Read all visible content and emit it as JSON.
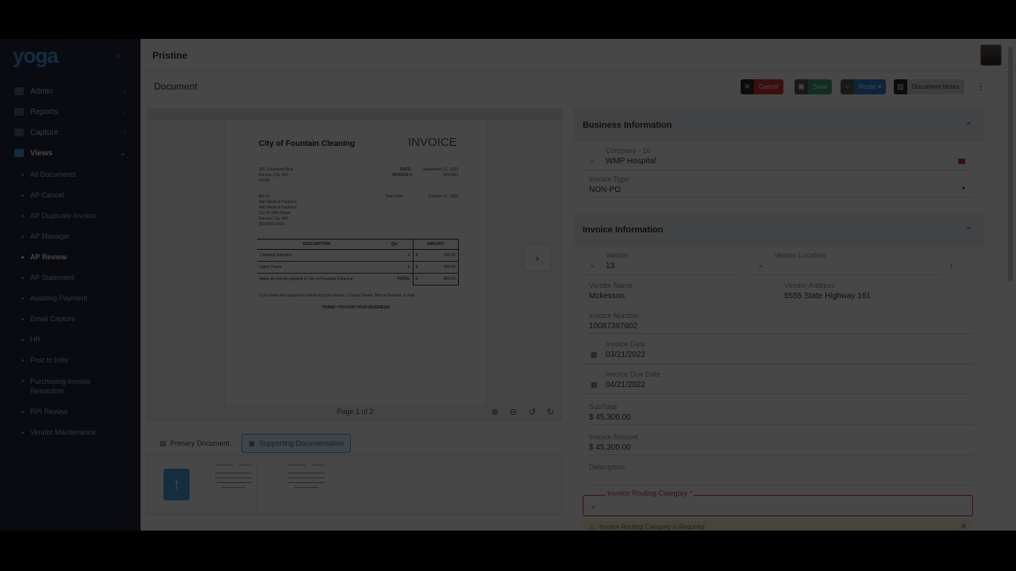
{
  "sidebar": {
    "logo": "yoga",
    "top_items": [
      {
        "label": "Admin",
        "icon": "admin-icon"
      },
      {
        "label": "Reports",
        "icon": "reports-icon"
      },
      {
        "label": "Capture",
        "icon": "capture-icon"
      },
      {
        "label": "Views",
        "icon": "views-icon"
      }
    ],
    "views_items": [
      "All Documents",
      "AP Cancel",
      "AP Duplicate Invoice",
      "AP Manager",
      "AP Review",
      "AP Statement",
      "Awaiting Payment",
      "Email Capture",
      "HR",
      "Post to Infor",
      "Purchasing Invoice Resolution",
      "RPI Review",
      "Vendor Maintenance"
    ],
    "active_item": "AP Review"
  },
  "header": {
    "title": "Pristine"
  },
  "document": {
    "title": "Document",
    "toolbar": {
      "cancel": "Cancel",
      "save": "Save",
      "route": "Route",
      "notes": "Document Notes"
    },
    "viewer": {
      "page_info": "Page 1 of 2"
    },
    "tabs": {
      "primary": "Primary Document",
      "supporting": "Supporting Documentation"
    },
    "invoice_preview": {
      "company": "City of Fountain Cleaning",
      "heading": "INVOICE",
      "address": [
        "101 Southeast Blvd",
        "Kansas City, MO",
        "64106"
      ],
      "date_label": "DATE:",
      "date": "September 21, 2021",
      "invoice_label": "INVOICE #",
      "invoice_no": "INV1001",
      "bill_to_label": "Bill To:",
      "bill_to": [
        "Attn Medical Partners",
        "Attn Medical Partners",
        "111 W 20th Street",
        "Kansas City, MO",
        "(816)555-5555"
      ],
      "due_label": "Due Date:",
      "due_date": "October 21, 2021",
      "columns": [
        "DESCRIPTION",
        "Qty",
        "AMOUNT"
      ],
      "rows": [
        {
          "desc": "Cleaning Supplies",
          "qty": "1",
          "cur": "$",
          "amount": "350.00"
        },
        {
          "desc": "Labor Hours",
          "qty": "5",
          "cur": "$",
          "amount": "450.00"
        }
      ],
      "checks_note": "Make all checks payable to City of Fountain Cleaning",
      "total_label": "TOTAL",
      "total_cur": "$",
      "total": "800.00",
      "questions": "If you have any questions concerning this invoice, Contact Name, Phone Number, E-mail",
      "thanks": "THANK YOU FOR YOUR BUSINESS!"
    }
  },
  "business": {
    "title": "Business Information",
    "company_label": "Company - 10",
    "company_value": "WMP Hospital",
    "invoice_type_label": "Invoice Type",
    "invoice_type_value": "NON-PO"
  },
  "invoice": {
    "title": "Invoice Information",
    "vendor_label": "Vendor",
    "vendor_value": "13",
    "vendor_location_label": "Vendor Location",
    "vendor_name_label": "Vendor Name",
    "vendor_name_value": "Mckesson",
    "vendor_address_label": "Vendor Address",
    "vendor_address_value": "5555 State Highway 161",
    "invoice_number_label": "Invoice Number",
    "invoice_number_value": "10087397602",
    "invoice_date_label": "Invoice Date",
    "invoice_date_value": "03/21/2022",
    "invoice_due_label": "Invoice Due Date",
    "invoice_due_value": "04/21/2022",
    "subtotal_label": "SubTotal",
    "subtotal_value": "$ 45,300.00",
    "amount_label": "Invoice Amount",
    "amount_value": "$ 45,300.00",
    "description_label": "Description",
    "routing_label": "Invoice Routing Category",
    "routing_warning": "Invoice Routing Category is Required"
  }
}
